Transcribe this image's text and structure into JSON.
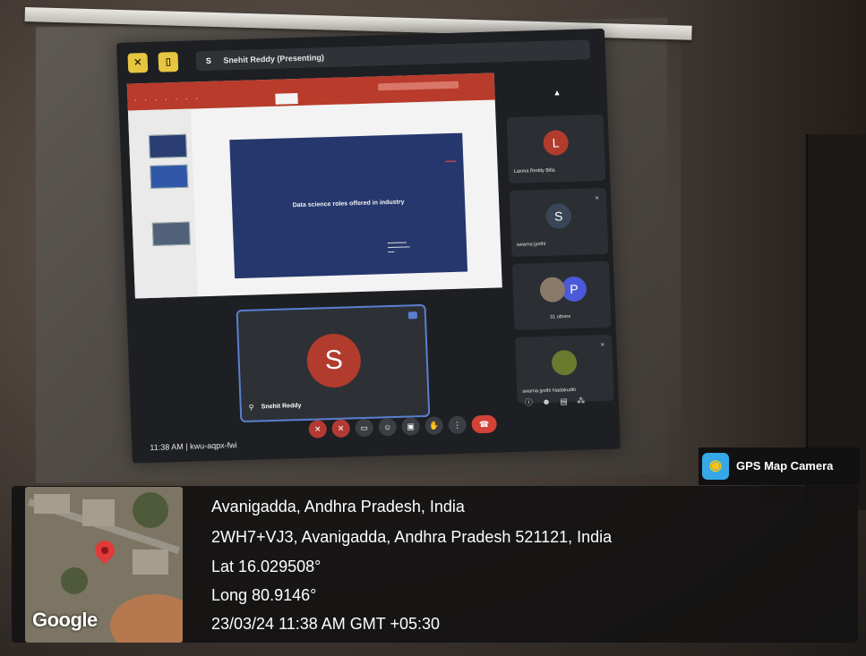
{
  "meet": {
    "presenter_avatar": "S",
    "presenter_label": "Snehit Reddy (Presenting)",
    "slide_title": "Data science roles offered in industry",
    "self_avatar": "S",
    "self_name": "Snehit Reddy",
    "meeting_time": "11:38 AM",
    "meeting_code": "kwu-aqpx-fwi",
    "participants": [
      {
        "avatar": "L",
        "name": "Laxma Reddy Billa",
        "color": "#b13b2c"
      },
      {
        "avatar": "S",
        "name": "swarna jyothi",
        "color": "#3a4656"
      },
      {
        "avatar": "P",
        "name": "31 others",
        "color": "#4a5ad8"
      },
      {
        "avatar": "",
        "name": "swarna jyothi Nadakuditi",
        "color": "#6b7a2e"
      }
    ]
  },
  "gps": {
    "brand": "GPS Map Camera",
    "map_logo": "Google",
    "line1": "Avanigadda, Andhra Pradesh, India",
    "line2": "2WH7+VJ3, Avanigadda, Andhra Pradesh 521121, India",
    "line3": "Lat 16.029508°",
    "line4": "Long 80.9146°",
    "line5": "23/03/24 11:38 AM GMT +05:30"
  }
}
